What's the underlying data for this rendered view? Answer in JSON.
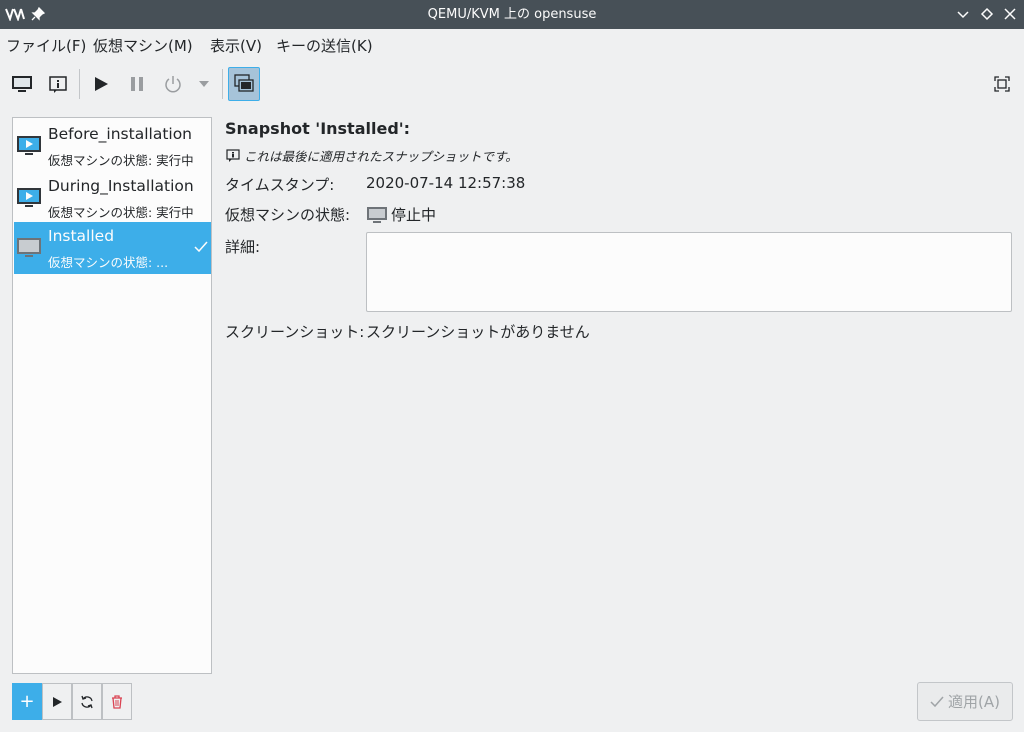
{
  "window": {
    "title": "QEMU/KVM 上の opensuse"
  },
  "menu": {
    "file": "ファイル(F)",
    "vm": "仮想マシン(M)",
    "view": "表示(V)",
    "sendkey": "キーの送信(K)"
  },
  "snapshots": [
    {
      "name": "Before_installation",
      "state": "仮想マシンの状態: 実行中"
    },
    {
      "name": "During_Installation",
      "state": "仮想マシンの状態: 実行中"
    },
    {
      "name": "Installed",
      "state": "仮想マシンの状態: ..."
    }
  ],
  "details": {
    "title": "Snapshot 'Installed':",
    "note": "これは最後に適用されたスナップショットです。",
    "timestamp_label": "タイムスタンプ:",
    "timestamp_value": "2020-07-14 12:57:38",
    "vmstate_label": "仮想マシンの状態:",
    "vmstate_value": "停止中",
    "description_label": "詳細:",
    "description_value": "",
    "screenshot_label": "スクリーンショット:",
    "screenshot_value": "スクリーンショットがありません"
  },
  "buttons": {
    "add": "+",
    "apply": "適用(A)"
  },
  "colors": {
    "accent": "#3daee9",
    "titlebar": "#475057",
    "background": "#eff0f1"
  }
}
